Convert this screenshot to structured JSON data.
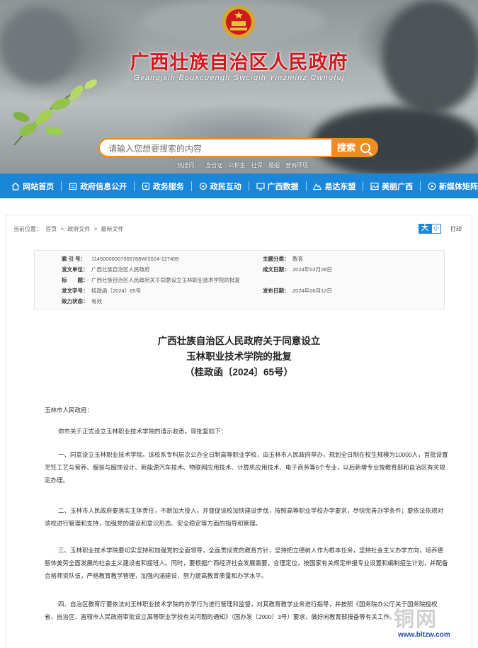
{
  "header": {
    "title": "广西壮族自治区人民政府",
    "subtitle": "Gvangjsih Bouxcuengh Swcigih Yinzminz Cwngfuj",
    "search_placeholder": "请输入您想要搜索的内容",
    "search_button": "搜索",
    "hot_label": "热搜词：",
    "hot_words": [
      "身份证",
      "公积金",
      "社保",
      "婚姻",
      "营商环境"
    ]
  },
  "nav": [
    {
      "label": "网站首页",
      "icon": "home-icon"
    },
    {
      "label": "政府信息公开",
      "icon": "document-icon"
    },
    {
      "label": "政务服务",
      "icon": "service-icon"
    },
    {
      "label": "政民互动",
      "icon": "chat-icon"
    },
    {
      "label": "广西数据",
      "icon": "data-icon"
    },
    {
      "label": "易达东盟",
      "icon": "mountain-icon"
    },
    {
      "label": "美丽广西",
      "icon": "scenery-icon"
    },
    {
      "label": "新媒体矩阵",
      "icon": "media-icon"
    }
  ],
  "breadcrumb": {
    "label": "当前位置：",
    "items": [
      "首页",
      ">",
      "政府文件",
      ">",
      "最新文件"
    ]
  },
  "tools": {
    "big": "大",
    "small": "小",
    "print": "打印"
  },
  "meta": {
    "index_label": "索 引 号：",
    "index_value": "11450000007565768W/2024-127499",
    "topic_label": "主题分类：",
    "topic_value": "教育",
    "issuer_label": "发文单位：",
    "issuer_value": "广西壮族自治区人民政府",
    "date_label": "成文日期：",
    "date_value": "2024年03月28日",
    "title_label": "标　　题：",
    "title_value": "广西壮族自治区人民政府关于同意设立玉林职业技术学院的批复",
    "docno_label": "发文字号：",
    "docno_value": "桂政函〔2024〕65号",
    "pubdate_label": "发布日期：",
    "pubdate_value": "2024年06月12日",
    "valid_label": "效力状态：",
    "valid_value": "有效"
  },
  "document": {
    "title_line1": "广西壮族自治区人民政府关于同意设立",
    "title_line2": "玉林职业技术学院的批复",
    "title_line3": "（桂政函〔2024〕65号）",
    "addressee": "玉林市人民政府：",
    "p1": "你市关于正式设立玉林职业技术学院的请示收悉。现批复如下：",
    "p2": "一、同意设立玉林职业技术学院。该校系专科层次公办全日制高等职业学校，由玉林市人民政府举办，规划全日制在校生规模为10000人，首批设置烹饪工艺与营养、服装与服饰设计、新能源汽车技术、物联网应用技术、计算机应用技术、电子商务等6个专业，以后新增专业按教育部和自治区有关规定办理。",
    "p3": "二、玉林市人民政府要落实主体责任，不断加大投入，并督促该校加快建设步伐，按照高等职业学校办学要求，尽快完善办学条件；要依法依规对该校进行管理和支持，加强党的建设和意识形态、安全稳定等方面的指导和管理。",
    "p4": "三、玉林职业技术学院要切实坚持和加强党的全面领导，全面贯彻党的教育方针，坚持把立德树人作为根本任务，坚持社会主义办学方向，培养德智体美劳全面发展的社会主义建设者和接班人。同时，要根据广西经济社会发展需要，合理定位，按国家有关规定申报专业设置和编制招生计划，并配备合格师资队伍，严格教育教学管理，加强内涵建设，努力提高教育质量和办学水平。",
    "p5": "四、自治区教育厅要依法对玉林职业技术学院的办学行为进行管理和监督，对其教育教学业务进行指导，并按照《国务院办公厅关于国务院授权省、自治区、直辖市人民政府审批设立高等职业学校有关问题的通知》（国办发〔2000〕3号）要求，做好向教育部报备等有关工作。"
  },
  "watermark": {
    "text": "铜网",
    "url": "www.bltzw.com"
  }
}
